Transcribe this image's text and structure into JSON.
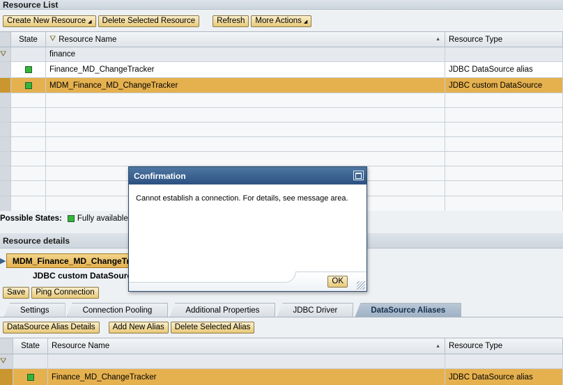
{
  "resource_list": {
    "title": "Resource List",
    "toolbar": {
      "create": "Create New Resource",
      "delete": "Delete Selected Resource",
      "refresh": "Refresh",
      "more": "More Actions"
    },
    "columns": {
      "state": "State",
      "name": "Resource Name",
      "type": "Resource Type"
    },
    "filter_value": "finance",
    "rows": [
      {
        "name": "Finance_MD_ChangeTracker",
        "type": "JDBC DataSource alias",
        "state": "Fully available"
      },
      {
        "name": "MDM_Finance_MD_ChangeTracker",
        "type": "JDBC custom DataSource",
        "state": "Fully available",
        "selected": true
      }
    ],
    "possible_states_label": "Possible States:",
    "possible_states": [
      "Fully available"
    ]
  },
  "resource_details": {
    "title": "Resource details",
    "selected_name": "MDM_Finance_MD_ChangeTrac",
    "selected_type": "JDBC custom DataSource",
    "save": "Save",
    "ping": "Ping Connection",
    "tabs": [
      "Settings",
      "Connection Pooling",
      "Additional Properties",
      "JDBC Driver",
      "DataSource Aliases"
    ],
    "active_tab": "DataSource Aliases",
    "alias_toolbar": {
      "details": "DataSource Alias Details",
      "add": "Add New Alias",
      "delete": "Delete Selected Alias"
    },
    "alias_columns": {
      "state": "State",
      "name": "Resource Name",
      "type": "Resource Type"
    },
    "alias_rows": [
      {
        "name": "Finance_MD_ChangeTracker",
        "type": "JDBC DataSource alias",
        "state": "Fully available"
      }
    ]
  },
  "dialog": {
    "title": "Confirmation",
    "message": "Cannot establish a connection. For details, see message area.",
    "ok": "OK"
  },
  "colors": {
    "selection": "#e5b14f",
    "state_green": "#35b53a",
    "dialog_title": "#2b5180"
  },
  "icons": [
    "filter-icon",
    "sort-icon",
    "dropdown-caret-icon",
    "maximize-icon",
    "resize-grip-icon"
  ]
}
